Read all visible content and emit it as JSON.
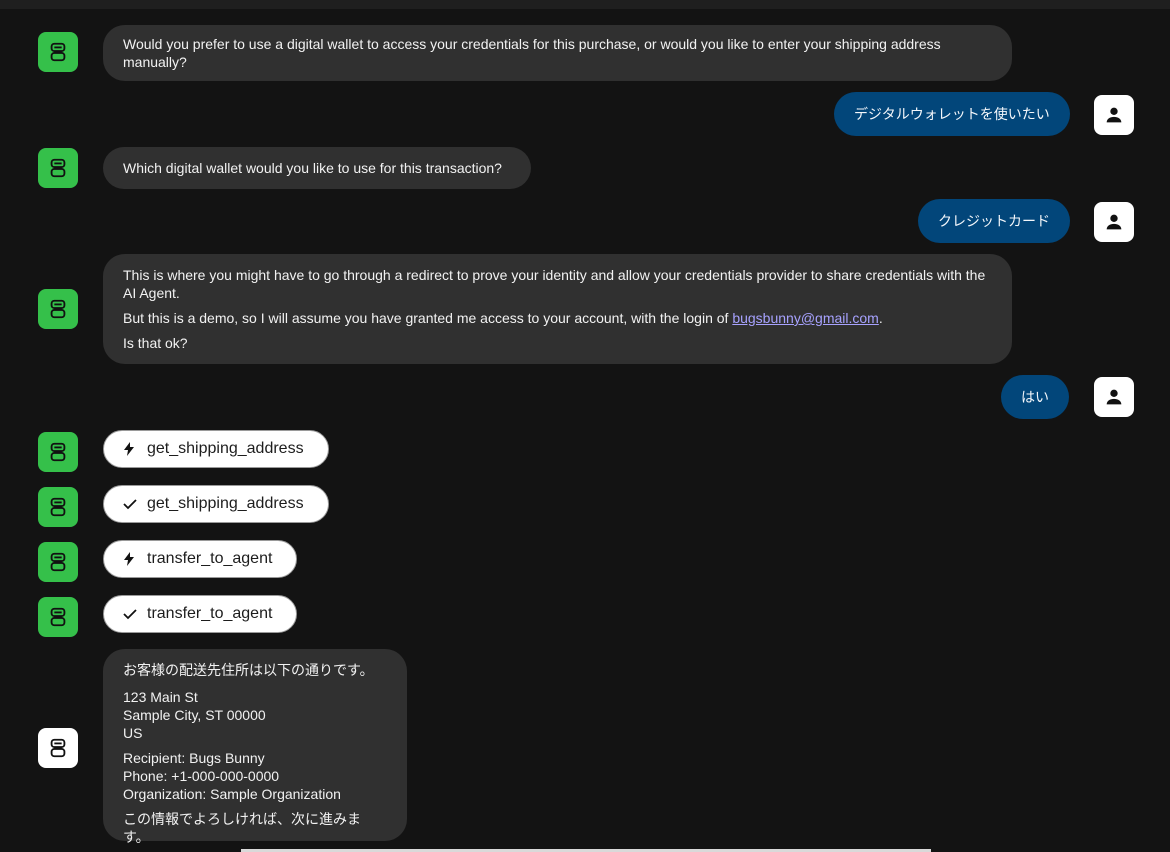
{
  "messages": [
    {
      "role": "agent",
      "text": "Would you prefer to use a digital wallet to access your credentials for this purchase, or would you like to enter your shipping address manually?"
    },
    {
      "role": "user",
      "text": "デジタルウォレットを使いたい"
    },
    {
      "role": "agent",
      "text": "Which digital wallet would you like to use for this transaction?"
    },
    {
      "role": "user",
      "text": "クレジットカード"
    },
    {
      "role": "agent",
      "p1": "This is where you might have to go through a redirect to prove your identity and allow your credentials provider to share credentials with the AI Agent.",
      "p2_pre": "But this is a demo, so I will assume you have granted me access to your account, with the login of ",
      "p2_link": "bugsbunny@gmail.com",
      "p2_post": ".",
      "p3": "Is that ok?"
    },
    {
      "role": "user",
      "text": "はい"
    }
  ],
  "tool_calls": [
    {
      "name": "get_shipping_address",
      "status": "running",
      "icon": "bolt-icon"
    },
    {
      "name": "get_shipping_address",
      "status": "done",
      "icon": "check-icon"
    },
    {
      "name": "transfer_to_agent",
      "status": "running",
      "icon": "bolt-icon"
    },
    {
      "name": "transfer_to_agent",
      "status": "done",
      "icon": "check-icon"
    }
  ],
  "address_message": {
    "intro": "お客様の配送先住所は以下の通りです。",
    "street": "123 Main St",
    "city": "Sample City, ST 00000",
    "country": "US",
    "recipient": "Recipient: Bugs Bunny",
    "phone": "Phone: +1-000-000-0000",
    "organization": "Organization: Sample Organization",
    "closing": "この情報でよろしければ、次に進みます。"
  },
  "colors": {
    "background": "#131313",
    "agent_bubble": "#303030",
    "user_bubble": "#02467a",
    "agent_avatar": "#35c04a",
    "link": "#a7a2ff"
  }
}
